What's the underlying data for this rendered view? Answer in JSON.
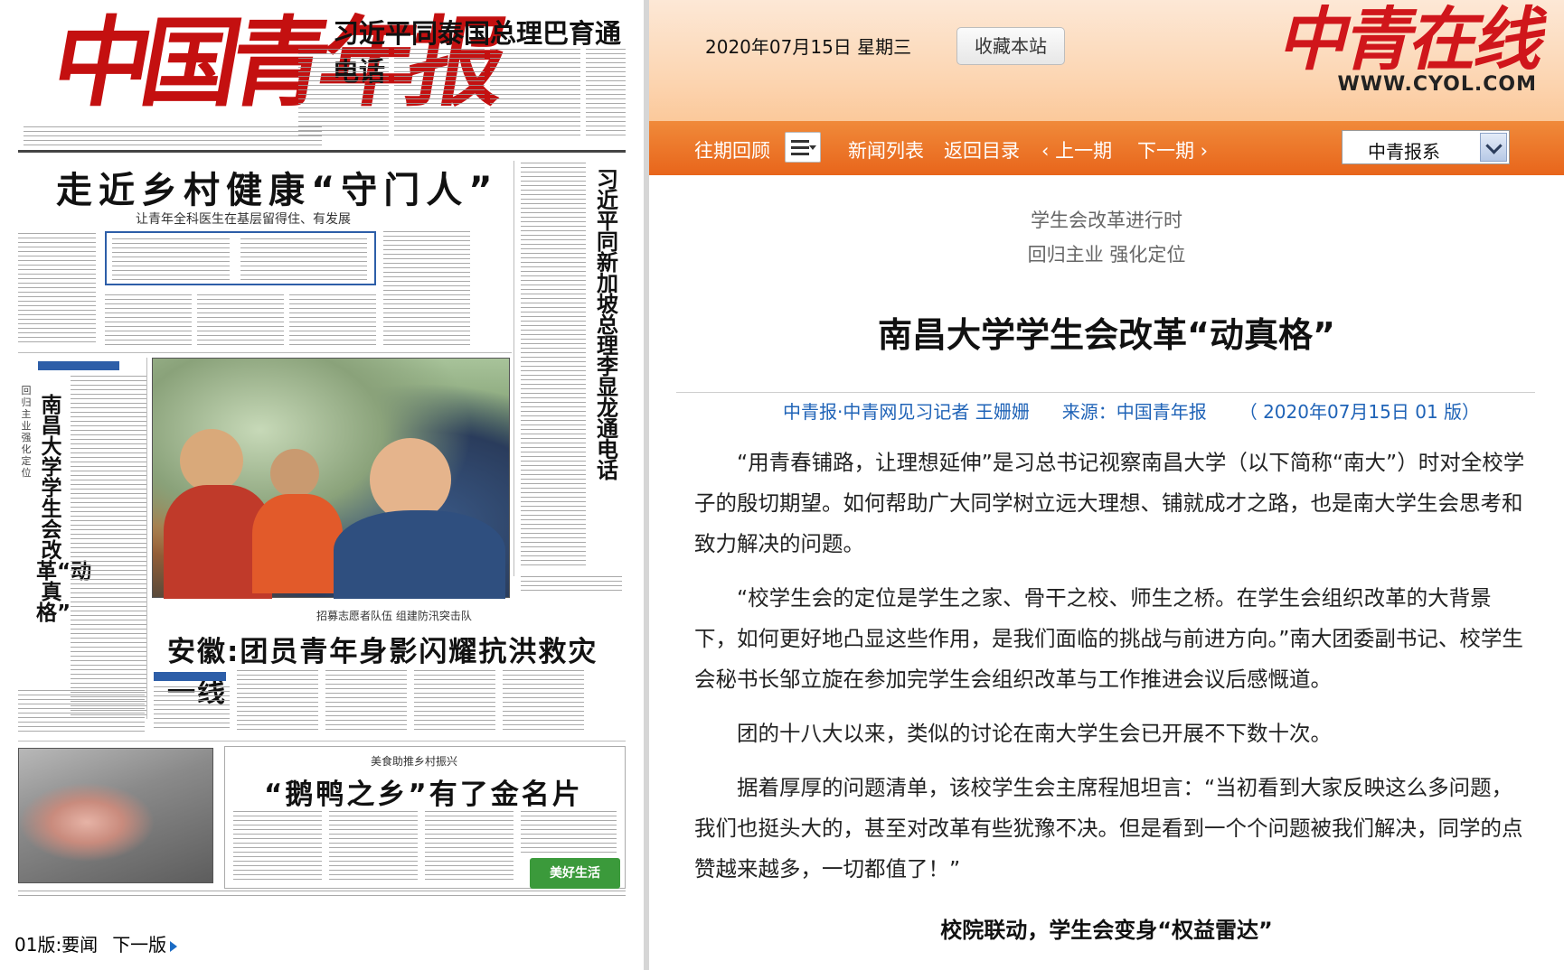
{
  "newspaper": {
    "masthead": "中国青年报",
    "top_headline": "习近平同泰国总理巴育通电话",
    "lead_headline": "走近乡村健康“守门人”",
    "lead_subheadline": "让青年全科医生在基层留得住、有发展",
    "vertical_headline": "习近平同新加坡总理李显龙通电话",
    "side_headline": "南昌大学学生会改革“动真格”",
    "side_kicker": "回归主业 强化定位",
    "flood_kicker": "招募志愿者队伍 组建防汛突击队",
    "flood_headline": "安徽:团员青年身影闪耀抗洪救灾一线",
    "goose_kicker": "美食助推乡村振兴",
    "goose_headline": "“鹅鸭之乡”有了金名片",
    "green_logo": "美好生活"
  },
  "page_nav": {
    "current": "01版:要闻",
    "next": "下一版"
  },
  "header": {
    "date": "2020年07月15日  星期三",
    "favorite_button": "收藏本站",
    "logo_text": "中青在线",
    "logo_url": "WWW.CYOL.COM"
  },
  "nav": {
    "archive": "往期回顾",
    "news_list": "新闻列表",
    "back_to_index": "返回目录",
    "prev_issue": "‹ 上一期",
    "next_issue": "下一期 ›",
    "select_value": "中青报系"
  },
  "article": {
    "kicker_1": "学生会改革进行时",
    "kicker_2": "回归主业 强化定位",
    "title": "南昌大学学生会改革“动真格”",
    "byline_author": "中青报·中青网见习记者 王姗姗",
    "byline_source": "来源：中国青年报",
    "byline_date": "（ 2020年07月15日   01 版）",
    "paragraphs": [
      "“用青春铺路，让理想延伸”是习总书记视察南昌大学（以下简称“南大”）时对全校学子的殷切期望。如何帮助广大同学树立远大理想、铺就成才之路，也是南大学生会思考和致力解决的问题。",
      "“校学生会的定位是学生之家、骨干之校、师生之桥。在学生会组织改革的大背景下，如何更好地凸显这些作用，是我们面临的挑战与前进方向。”南大团委副书记、校学生会秘书长邹立旋在参加完学生会组织改革与工作推进会议后感慨道。",
      "团的十八大以来，类似的讨论在南大学生会已开展不下数十次。",
      "据着厚厚的问题清单，该校学生会主席程旭坦言：“当初看到大家反映这么多问题，我们也挺头大的，甚至对改革有些犹豫不决。但是看到一个个问题被我们解决，同学的点赞越来越多，一切都值了！”"
    ],
    "subhead": "校院联动，学生会变身“权益雷达”"
  },
  "colors": {
    "nav_orange": "#e8651b",
    "header_peach": "#fcd7b5",
    "logo_red": "#d0161b",
    "byline_blue": "#1f63b7",
    "masthead_red": "#c41010"
  }
}
